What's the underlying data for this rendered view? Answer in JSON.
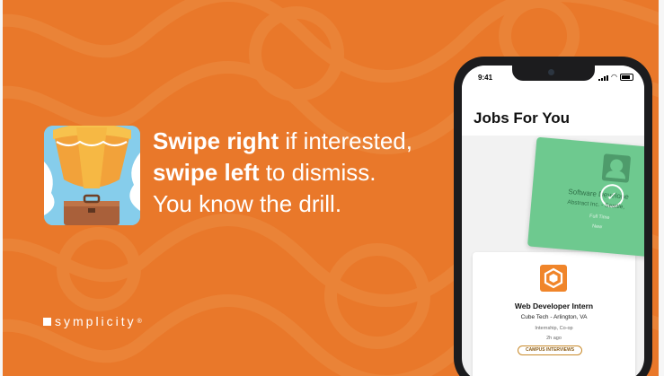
{
  "colors": {
    "background": "#e9782a",
    "text": "#ffffff",
    "swiped_card": "#6ec98f",
    "job_logo": "#f0852a",
    "badge_border": "#c98a2a"
  },
  "app_icon": {
    "name": "hot-air-balloon-icon"
  },
  "headline": {
    "line1_bold": "Swipe right",
    "line1_rest": " if interested,",
    "line2_bold": "swipe left",
    "line2_rest": " to dismiss.",
    "line3": "You know the drill."
  },
  "brand": {
    "name": "symplicity",
    "mark": "®"
  },
  "phone": {
    "status_time": "9:41",
    "screen_title": "Jobs For You",
    "swiped_card": {
      "title": "Software Develope",
      "company": "Abstract Inc. - Seattle,",
      "type": "Full Time",
      "posted": "New",
      "icon": "person-icon",
      "check_icon": "check-icon"
    },
    "job_card": {
      "title": "Web Developer Intern",
      "company": "Cube Tech - Arlington, VA",
      "type": "Internship, Co-op",
      "posted": "2h ago",
      "badge": "CAMPUS INTERVIEWS",
      "icon": "hexagon-cube-icon"
    }
  }
}
